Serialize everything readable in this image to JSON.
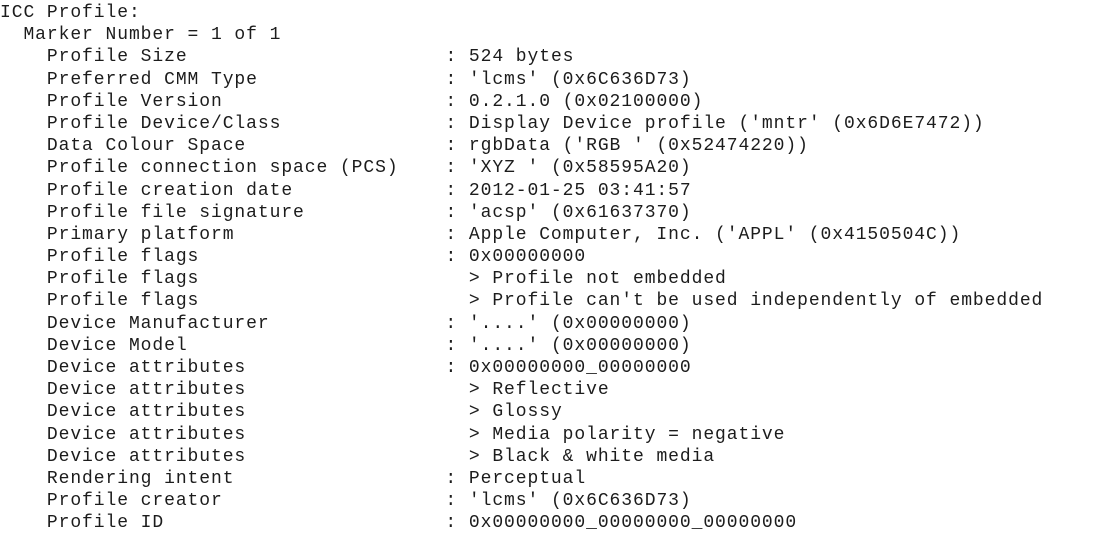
{
  "document": {
    "kind": "exiftool-icc-profile-dump",
    "background_color": "#ffffff",
    "text_color": "#1c1c1c",
    "heading": "ICC Profile:",
    "subheading": "  Marker Number = 1 of 1",
    "separator": ":",
    "continuation_marker": ">"
  },
  "lines": [
    {
      "indent": "",
      "label": "ICC Profile:",
      "has_colon": false,
      "value": "",
      "raw": "ICC Profile:"
    },
    {
      "indent": "  ",
      "label": "Marker Number = 1 of 1",
      "has_colon": false,
      "value": "",
      "raw": "  Marker Number = 1 of 1"
    },
    {
      "indent": "    ",
      "label": "Profile Size",
      "has_colon": true,
      "value": "524 bytes",
      "raw": "    Profile Size                      : 524 bytes"
    },
    {
      "indent": "    ",
      "label": "Preferred CMM Type",
      "has_colon": true,
      "value": "'lcms' (0x6C636D73)",
      "raw": "    Preferred CMM Type                : 'lcms' (0x6C636D73)"
    },
    {
      "indent": "    ",
      "label": "Profile Version",
      "has_colon": true,
      "value": "0.2.1.0 (0x02100000)",
      "raw": "    Profile Version                   : 0.2.1.0 (0x02100000)"
    },
    {
      "indent": "    ",
      "label": "Profile Device/Class",
      "has_colon": true,
      "value": "Display Device profile ('mntr' (0x6D6E7472))",
      "raw": "    Profile Device/Class              : Display Device profile ('mntr' (0x6D6E7472))"
    },
    {
      "indent": "    ",
      "label": "Data Colour Space",
      "has_colon": true,
      "value": "rgbData ('RGB ' (0x52474220))",
      "raw": "    Data Colour Space                 : rgbData ('RGB ' (0x52474220))"
    },
    {
      "indent": "    ",
      "label": "Profile connection space (PCS)",
      "has_colon": true,
      "value": "'XYZ ' (0x58595A20)",
      "raw": "    Profile connection space (PCS)    : 'XYZ ' (0x58595A20)"
    },
    {
      "indent": "    ",
      "label": "Profile creation date",
      "has_colon": true,
      "value": "2012-01-25 03:41:57",
      "raw": "    Profile creation date             : 2012-01-25 03:41:57"
    },
    {
      "indent": "    ",
      "label": "Profile file signature",
      "has_colon": true,
      "value": "'acsp' (0x61637370)",
      "raw": "    Profile file signature            : 'acsp' (0x61637370)"
    },
    {
      "indent": "    ",
      "label": "Primary platform",
      "has_colon": true,
      "value": "Apple Computer, Inc. ('APPL' (0x4150504C))",
      "raw": "    Primary platform                  : Apple Computer, Inc. ('APPL' (0x4150504C))"
    },
    {
      "indent": "    ",
      "label": "Profile flags",
      "has_colon": true,
      "value": "0x00000000",
      "raw": "    Profile flags                     : 0x00000000"
    },
    {
      "indent": "    ",
      "label": "Profile flags",
      "has_colon": false,
      "value": "> Profile not embedded",
      "raw": "    Profile flags                       > Profile not embedded"
    },
    {
      "indent": "    ",
      "label": "Profile flags",
      "has_colon": false,
      "value": "> Profile can't be used independently of embedded",
      "raw": "    Profile flags                       > Profile can't be used independently of embedded"
    },
    {
      "indent": "    ",
      "label": "Device Manufacturer",
      "has_colon": true,
      "value": "'....' (0x00000000)",
      "raw": "    Device Manufacturer               : '....' (0x00000000)"
    },
    {
      "indent": "    ",
      "label": "Device Model",
      "has_colon": true,
      "value": "'....' (0x00000000)",
      "raw": "    Device Model                      : '....' (0x00000000)"
    },
    {
      "indent": "    ",
      "label": "Device attributes",
      "has_colon": true,
      "value": "0x00000000_00000000",
      "raw": "    Device attributes                 : 0x00000000_00000000"
    },
    {
      "indent": "    ",
      "label": "Device attributes",
      "has_colon": false,
      "value": "> Reflective",
      "raw": "    Device attributes                   > Reflective"
    },
    {
      "indent": "    ",
      "label": "Device attributes",
      "has_colon": false,
      "value": "> Glossy",
      "raw": "    Device attributes                   > Glossy"
    },
    {
      "indent": "    ",
      "label": "Device attributes",
      "has_colon": false,
      "value": "> Media polarity = negative",
      "raw": "    Device attributes                   > Media polarity = negative"
    },
    {
      "indent": "    ",
      "label": "Device attributes",
      "has_colon": false,
      "value": "> Black & white media",
      "raw": "    Device attributes                   > Black & white media"
    },
    {
      "indent": "    ",
      "label": "Rendering intent",
      "has_colon": true,
      "value": "Perceptual",
      "raw": "    Rendering intent                  : Perceptual"
    },
    {
      "indent": "    ",
      "label": "Profile creator",
      "has_colon": true,
      "value": "'lcms' (0x6C636D73)",
      "raw": "    Profile creator                   : 'lcms' (0x6C636D73)"
    },
    {
      "indent": "    ",
      "label": "Profile ID",
      "has_colon": true,
      "value": "0x00000000_00000000_00000000",
      "raw": "    Profile ID                        : 0x00000000_00000000_00000000"
    }
  ]
}
